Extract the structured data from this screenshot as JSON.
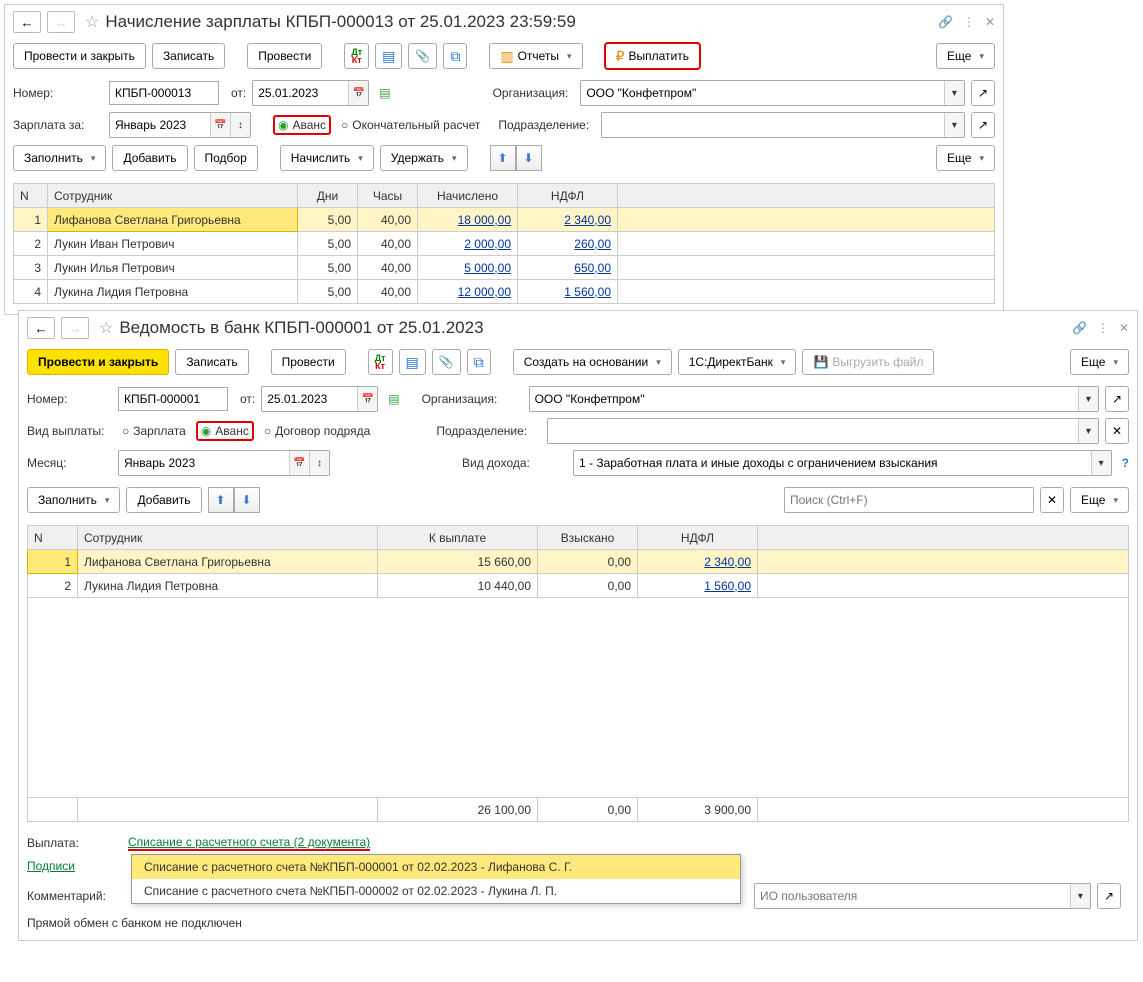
{
  "win1": {
    "title": "Начисление зарплаты КПБП-000013 от 25.01.2023 23:59:59",
    "toolbar": {
      "post_close": "Провести и закрыть",
      "write": "Записать",
      "post": "Провести",
      "reports": "Отчеты",
      "pay": "Выплатить",
      "more": "Еще"
    },
    "form": {
      "number_label": "Номер:",
      "number": "КПБП-000013",
      "from_label": "от:",
      "date": "25.01.2023",
      "org_label": "Организация:",
      "org": "ООО \"Конфетпром\"",
      "salary_for_label": "Зарплата за:",
      "salary_for": "Январь 2023",
      "radio_advance": "Аванс",
      "radio_final": "Окончательный расчет",
      "dept_label": "Подразделение:",
      "dept": ""
    },
    "subbar": {
      "fill": "Заполнить",
      "add": "Добавить",
      "pick": "Подбор",
      "accrue": "Начислить",
      "withhold": "Удержать",
      "more": "Еще"
    },
    "table": {
      "cols": [
        "N",
        "Сотрудник",
        "Дни",
        "Часы",
        "Начислено",
        "НДФЛ"
      ],
      "rows": [
        {
          "n": "1",
          "name": "Лифанова Светлана Григорьевна",
          "days": "5,00",
          "hours": "40,00",
          "accrued": "18 000,00",
          "ndfl": "2 340,00"
        },
        {
          "n": "2",
          "name": "Лукин Иван Петрович",
          "days": "5,00",
          "hours": "40,00",
          "accrued": "2 000,00",
          "ndfl": "260,00"
        },
        {
          "n": "3",
          "name": "Лукин Илья Петрович",
          "days": "5,00",
          "hours": "40,00",
          "accrued": "5 000,00",
          "ndfl": "650,00"
        },
        {
          "n": "4",
          "name": "Лукина Лидия Петровна",
          "days": "5,00",
          "hours": "40,00",
          "accrued": "12 000,00",
          "ndfl": "1 560,00"
        }
      ]
    }
  },
  "win2": {
    "title": "Ведомость в банк КПБП-000001 от 25.01.2023",
    "toolbar": {
      "post_close": "Провести и закрыть",
      "write": "Записать",
      "post": "Провести",
      "create_basis": "Создать на основании",
      "directbank": "1С:ДиректБанк",
      "export": "Выгрузить файл",
      "more": "Еще"
    },
    "form": {
      "number_label": "Номер:",
      "number": "КПБП-000001",
      "from_label": "от:",
      "date": "25.01.2023",
      "org_label": "Организация:",
      "org": "ООО \"Конфетпром\"",
      "type_label": "Вид выплаты:",
      "radio_salary": "Зарплата",
      "radio_advance": "Аванс",
      "radio_contract": "Договор подряда",
      "dept_label": "Подразделение:",
      "dept": "",
      "month_label": "Месяц:",
      "month": "Январь 2023",
      "income_label": "Вид дохода:",
      "income": "1 - Заработная плата и иные доходы с ограничением взыскания"
    },
    "subbar": {
      "fill": "Заполнить",
      "add": "Добавить",
      "search_ph": "Поиск (Ctrl+F)",
      "more": "Еще"
    },
    "table": {
      "cols": [
        "N",
        "Сотрудник",
        "К выплате",
        "Взыскано",
        "НДФЛ"
      ],
      "rows": [
        {
          "n": "1",
          "name": "Лифанова Светлана Григорьевна",
          "pay": "15 660,00",
          "coll": "0,00",
          "ndfl": "2 340,00"
        },
        {
          "n": "2",
          "name": "Лукина Лидия Петровна",
          "pay": "10 440,00",
          "coll": "0,00",
          "ndfl": "1 560,00"
        }
      ],
      "totals": {
        "pay": "26 100,00",
        "coll": "0,00",
        "ndfl": "3 900,00"
      }
    },
    "footer": {
      "pay_label": "Выплата:",
      "pay_link": "Списание с расчетного счета (2 документа)",
      "sign_link": "Подписи",
      "comment_label": "Комментарий:",
      "comment": "",
      "user_ph": "ИО пользователя",
      "bank_status": "Прямой обмен с банком не подключен"
    },
    "popup": {
      "item1": "Списание с расчетного счета №КПБП-000001 от 02.02.2023 - Лифанова С. Г.",
      "item2": "Списание с расчетного счета №КПБП-000002 от 02.02.2023 - Лукина Л. П."
    }
  }
}
